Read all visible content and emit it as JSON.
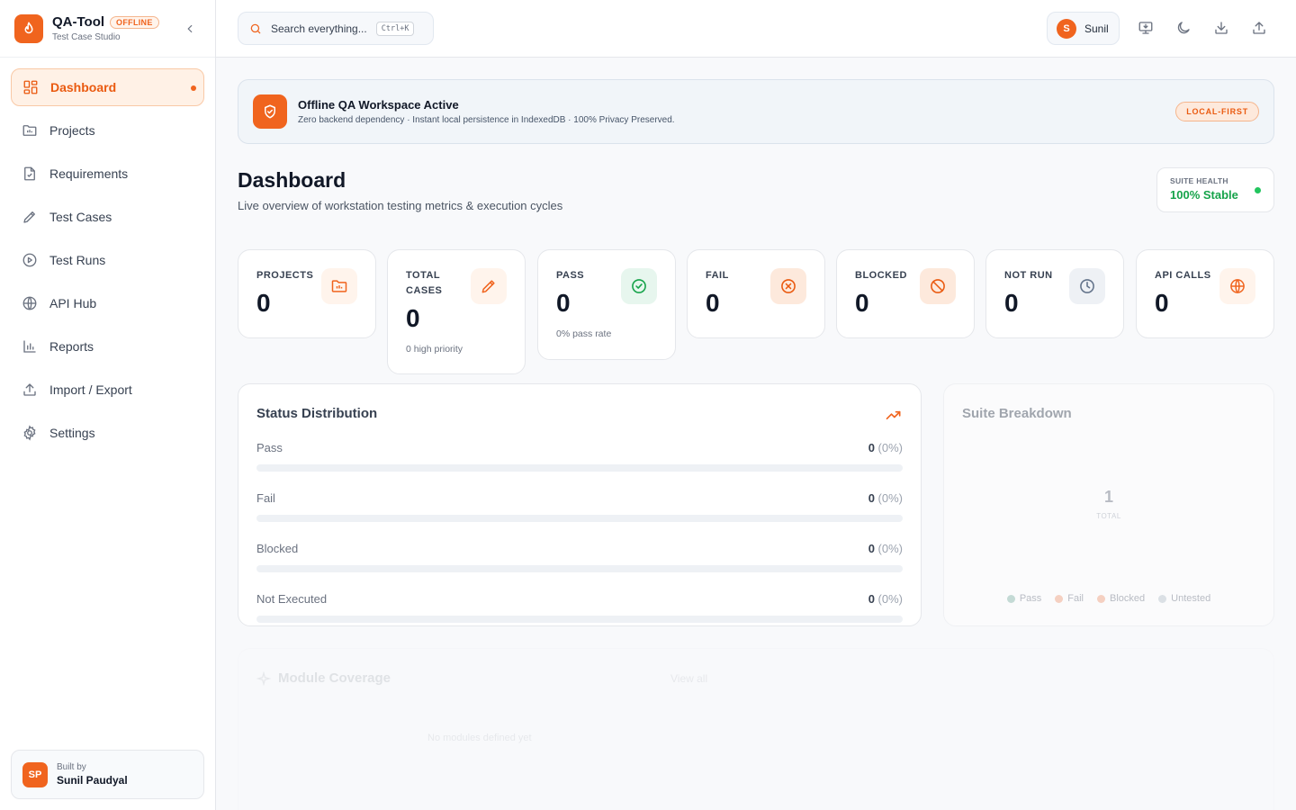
{
  "brand": {
    "name": "QA-Tool",
    "badge": "OFFLINE",
    "subtitle": "Test Case Studio"
  },
  "sidebar": {
    "items": [
      {
        "label": "Dashboard",
        "icon": "grid-icon",
        "active": true
      },
      {
        "label": "Projects",
        "icon": "folder-icon"
      },
      {
        "label": "Requirements",
        "icon": "file-check-icon"
      },
      {
        "label": "Test Cases",
        "icon": "pencil-icon"
      },
      {
        "label": "Test Runs",
        "icon": "play-circle-icon"
      },
      {
        "label": "API Hub",
        "icon": "globe-icon"
      },
      {
        "label": "Reports",
        "icon": "bar-chart-icon"
      },
      {
        "label": "Import / Export",
        "icon": "upload-icon"
      },
      {
        "label": "Settings",
        "icon": "gear-icon"
      }
    ],
    "author": {
      "initials": "SP",
      "label": "Built by",
      "name": "Sunil Paudyal"
    }
  },
  "header": {
    "search_placeholder": "Search everything...",
    "search_shortcut": "Ctrl+K",
    "user": {
      "initial": "S",
      "name": "Sunil"
    }
  },
  "banner": {
    "title": "Offline QA Workspace Active",
    "subtitle": "Zero backend dependency · Instant local persistence in IndexedDB · 100% Privacy Preserved.",
    "badge": "LOCAL-FIRST"
  },
  "page": {
    "title": "Dashboard",
    "subtitle": "Live overview of workstation testing metrics & execution cycles",
    "health_label": "SUITE HEALTH",
    "health_value": "100% Stable"
  },
  "stats": [
    {
      "label": "PROJECTS",
      "value": "0",
      "note": "",
      "icon": "folder-icon",
      "color": "#f0641e"
    },
    {
      "label": "TOTAL CASES",
      "value": "0",
      "note": "0 high priority",
      "icon": "pencil-icon",
      "color": "#f0641e"
    },
    {
      "label": "PASS",
      "value": "0",
      "note": "0% pass rate",
      "icon": "check-circle-icon",
      "color": "#16a34a"
    },
    {
      "label": "FAIL",
      "value": "0",
      "note": "",
      "icon": "x-circle-icon",
      "color": "#ea5a10"
    },
    {
      "label": "BLOCKED",
      "value": "0",
      "note": "",
      "icon": "ban-icon",
      "color": "#ea5a10"
    },
    {
      "label": "NOT RUN",
      "value": "0",
      "note": "",
      "icon": "clock-icon",
      "color": "#64748b"
    },
    {
      "label": "API CALLS",
      "value": "0",
      "note": "",
      "icon": "globe-icon",
      "color": "#f0641e"
    }
  ],
  "status_distribution": {
    "title": "Status Distribution",
    "rows": [
      {
        "label": "Pass",
        "count": "0",
        "pct": "(0%)"
      },
      {
        "label": "Fail",
        "count": "0",
        "pct": "(0%)"
      },
      {
        "label": "Blocked",
        "count": "0",
        "pct": "(0%)"
      },
      {
        "label": "Not Executed",
        "count": "0",
        "pct": "(0%)"
      }
    ]
  },
  "suite_breakdown": {
    "title": "Suite Breakdown",
    "total": "1",
    "total_label": "TOTAL",
    "legend": [
      {
        "label": "Pass",
        "color": "#86b6a8"
      },
      {
        "label": "Fail",
        "color": "#f2a07b"
      },
      {
        "label": "Blocked",
        "color": "#f2a07b"
      },
      {
        "label": "Untested",
        "color": "#b8c2cc"
      }
    ]
  },
  "module_coverage": {
    "title": "Module Coverage",
    "link": "View all",
    "empty": "No modules defined yet"
  }
}
